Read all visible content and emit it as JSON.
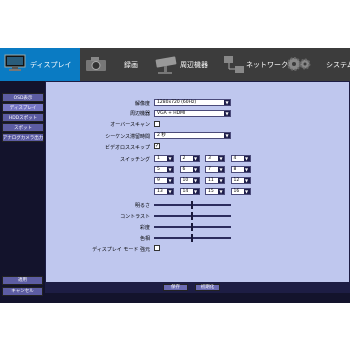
{
  "tabs": [
    {
      "label": "ディスプレイ",
      "icon": "monitor-icon",
      "active": true
    },
    {
      "label": "録画",
      "icon": "camera-icon",
      "active": false
    },
    {
      "label": "周辺機器",
      "icon": "cctv-camera-icon",
      "active": false
    },
    {
      "label": "ネットワーク",
      "icon": "network-icon",
      "active": false
    },
    {
      "label": "システム",
      "icon": "gears-icon",
      "active": false
    }
  ],
  "sidebar": {
    "items": [
      {
        "label": "OSD表示"
      },
      {
        "label": "ディスプレイ"
      },
      {
        "label": "HDDスポット"
      },
      {
        "label": "スポット"
      },
      {
        "label": "アナログカメラ出力"
      }
    ],
    "bottom_buttons": [
      {
        "label": "適用"
      },
      {
        "label": "キャンセル"
      }
    ]
  },
  "form": {
    "resolution": {
      "label": "解像度",
      "value": "1280x720 (60Hz)"
    },
    "peripheral": {
      "label": "周辺機器",
      "value": "VGA + HDMI"
    },
    "overscan": {
      "label": "オーバースキャン",
      "checked": false
    },
    "sequence_dwell": {
      "label": "シーケンス滞留時間",
      "value": "2 秒"
    },
    "video_loss_skip": {
      "label": "ビデオロススキップ",
      "checked": true
    },
    "switching": {
      "label": "スイッチング",
      "channels": [
        "1",
        "2",
        "3",
        "4",
        "5",
        "6",
        "7",
        "8",
        "9",
        "10",
        "11",
        "12",
        "13",
        "14",
        "15",
        "16"
      ]
    },
    "brightness": {
      "label": "明るさ"
    },
    "contrast": {
      "label": "コントラスト"
    },
    "hue": {
      "label": "彩度"
    },
    "color": {
      "label": "色相"
    },
    "display_mode": {
      "label": "ディスプレイ モード 強元",
      "checked": false
    }
  },
  "footer": {
    "buttons": [
      {
        "label": "保存"
      },
      {
        "label": "初期化"
      }
    ]
  },
  "colors": {
    "active_tab": "#0a7bc3",
    "panel": "#bfc7ee",
    "frame": "#13132c"
  }
}
